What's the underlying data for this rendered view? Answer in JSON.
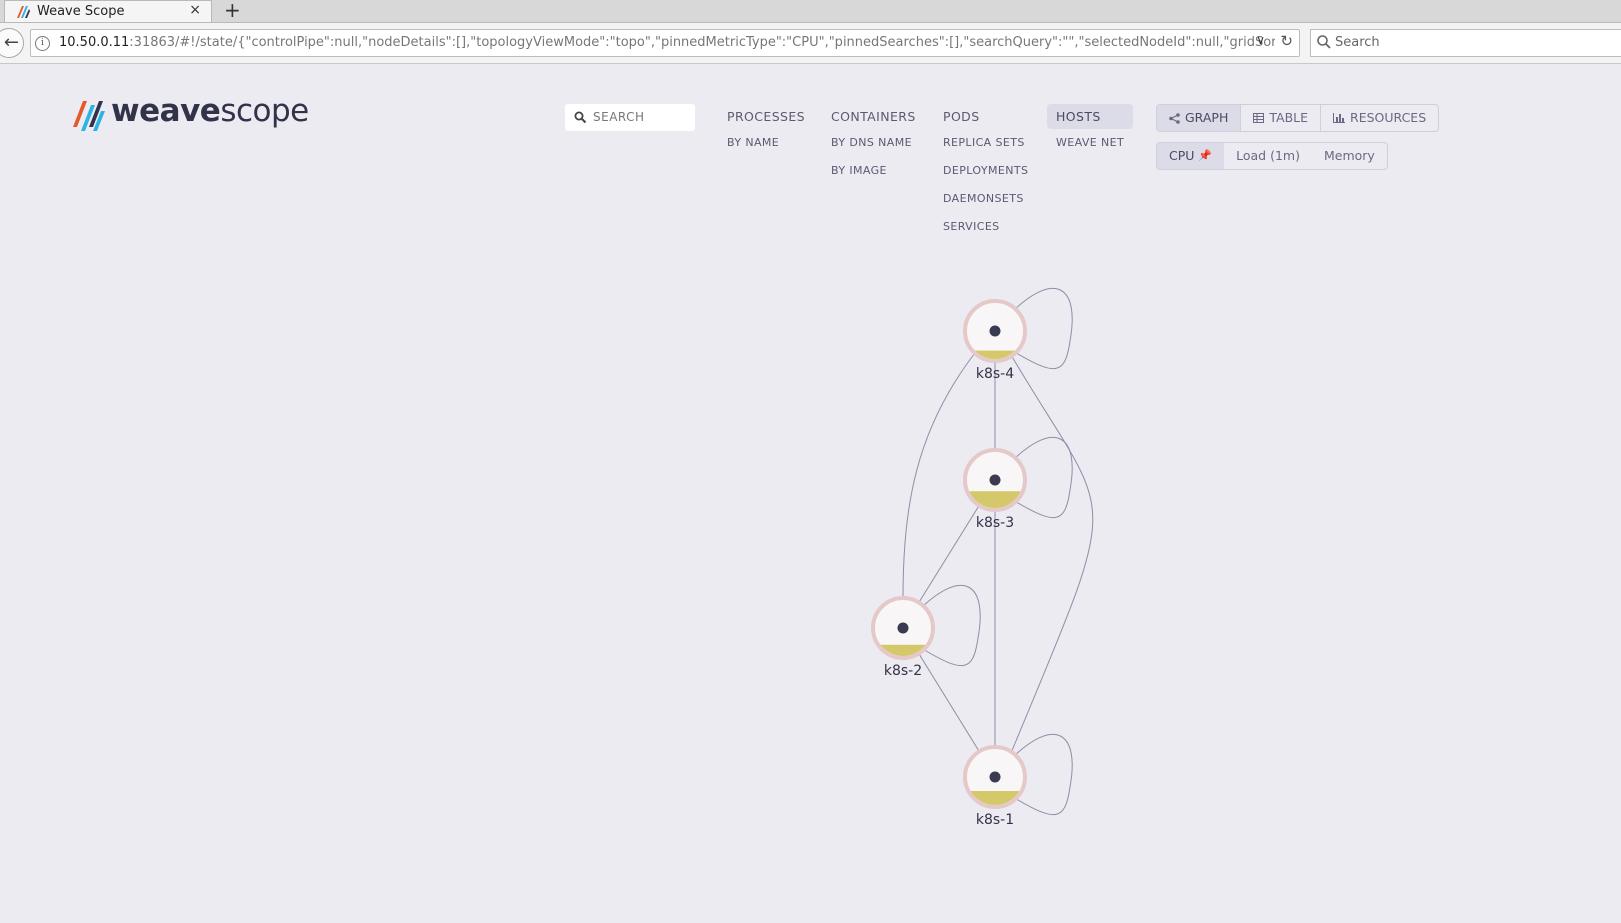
{
  "browser": {
    "tab_title": "Weave Scope",
    "close_glyph": "×",
    "new_tab_glyph": "+",
    "url_host": "10.50.0.11",
    "url_rest": ":31863/#!/state/{\"controlPipe\":null,\"nodeDetails\":[],\"topologyViewMode\":\"topo\",\"pinnedMetricType\":\"CPU\",\"pinnedSearches\":[],\"searchQuery\":\"\",\"selectedNodeId\":null,\"gridSortec",
    "search_placeholder": "Search"
  },
  "logo": {
    "part1": "weave",
    "part2": "scope"
  },
  "search": {
    "label": "SEARCH"
  },
  "topologies": [
    {
      "label": "PROCESSES",
      "subs": [
        "BY NAME"
      ]
    },
    {
      "label": "CONTAINERS",
      "subs": [
        "BY DNS NAME",
        "BY IMAGE"
      ]
    },
    {
      "label": "PODS",
      "subs": [
        "REPLICA SETS",
        "DEPLOYMENTS",
        "DAEMONSETS",
        "SERVICES"
      ]
    },
    {
      "label": "HOSTS",
      "subs": [
        "WEAVE NET"
      ],
      "active": true
    }
  ],
  "view_modes": [
    {
      "label": "GRAPH",
      "icon": "share-icon",
      "active": true
    },
    {
      "label": "TABLE",
      "icon": "table-icon"
    },
    {
      "label": "RESOURCES",
      "icon": "bar-chart-icon"
    }
  ],
  "metrics": [
    {
      "label": "CPU",
      "active": true,
      "pinned": true
    },
    {
      "label": "Load (1m)"
    },
    {
      "label": "Memory"
    }
  ],
  "graph": {
    "nodes": [
      {
        "id": "k8s-4",
        "label": "k8s-4",
        "cpu_fill": 0.15
      },
      {
        "id": "k8s-3",
        "label": "k8s-3",
        "cpu_fill": 0.3
      },
      {
        "id": "k8s-2",
        "label": "k8s-2",
        "cpu_fill": 0.2
      },
      {
        "id": "k8s-1",
        "label": "k8s-1",
        "cpu_fill": 0.25
      }
    ],
    "edges": [
      [
        "k8s-4",
        "k8s-3"
      ],
      [
        "k8s-3",
        "k8s-1"
      ],
      [
        "k8s-3",
        "k8s-2"
      ],
      [
        "k8s-2",
        "k8s-1"
      ],
      [
        "k8s-4",
        "k8s-2"
      ],
      [
        "k8s-4",
        "k8s-1"
      ]
    ],
    "self_loops": [
      "k8s-4",
      "k8s-3",
      "k8s-2",
      "k8s-1"
    ],
    "colors": {
      "ring": "#e4c9c8",
      "fill": "#d4c86a",
      "dot": "#3a3a50",
      "edge": "#8e8ea8"
    }
  }
}
